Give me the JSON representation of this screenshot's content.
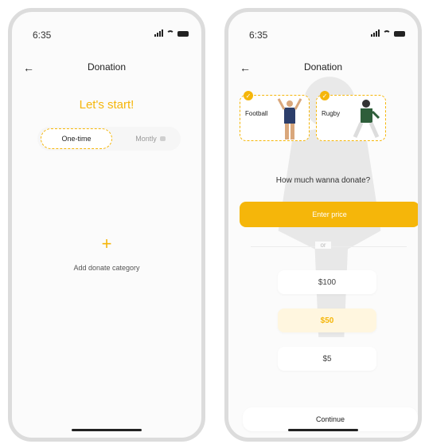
{
  "status": {
    "time": "6:35"
  },
  "left_screen": {
    "title": "Donation",
    "heading": "Let's start!",
    "tabs": [
      {
        "label": "One-time",
        "selected": true
      },
      {
        "label": "Montly",
        "selected": false
      }
    ],
    "add_icon": "+",
    "add_label": "Add donate category"
  },
  "right_screen": {
    "title": "Donation",
    "categories": [
      {
        "label": "Football",
        "checked": true
      },
      {
        "label": "Rugby",
        "checked": true
      }
    ],
    "question": "How much wanna donate?",
    "enter_price_label": "Enter price",
    "or_label": "or",
    "amounts": [
      "$100",
      "$50",
      "$5"
    ],
    "selected_amount": "$50",
    "continue_label": "Continue"
  },
  "colors": {
    "accent": "#f5b60a"
  }
}
